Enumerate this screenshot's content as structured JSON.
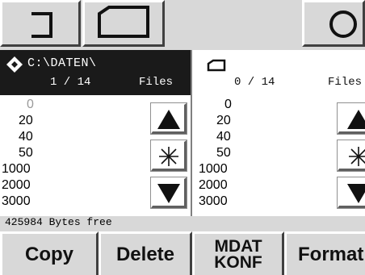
{
  "left_panel": {
    "path": "C:\\DATEN\\",
    "count": "1 / 14",
    "count_unit": "Files",
    "items": [
      "0",
      "20",
      "40",
      "50",
      "1000",
      "2000",
      "3000"
    ],
    "status": "425984 Bytes free"
  },
  "right_panel": {
    "count": "0 / 14",
    "count_unit": "Files",
    "items": [
      "0",
      "20",
      "40",
      "50",
      "1000",
      "2000",
      "3000"
    ]
  },
  "bottom_buttons": {
    "copy": "Copy",
    "delete": "Delete",
    "mdat_line1": "MDAT",
    "mdat_line2": "KONF",
    "format": "Format"
  },
  "icons": {
    "top_left": "close-bracket-icon",
    "top_second": "disk-outline-icon",
    "top_right": "circle-icon",
    "left_head": "diamond-arrow-icon",
    "right_head": "disk-outline-icon",
    "scroll_up": "triangle-up-icon",
    "select_all": "asterisk-icon",
    "scroll_down": "triangle-down-icon"
  },
  "colors": {
    "active_header": "#1a1a1a",
    "inactive_header": "#ffffff",
    "bar_gray": "#d8d8d8"
  }
}
